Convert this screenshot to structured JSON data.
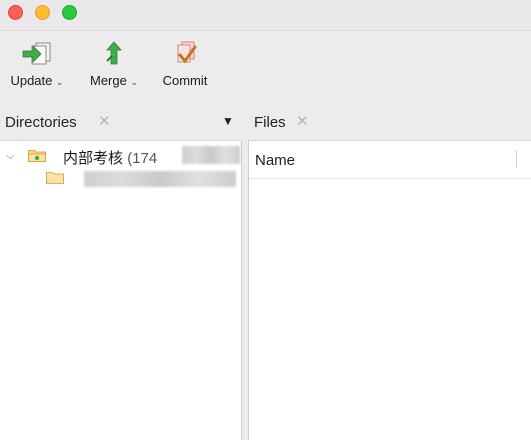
{
  "window": {
    "traffic_lights": [
      "close",
      "minimize",
      "maximize"
    ]
  },
  "toolbar": {
    "update_label": "Update",
    "merge_label": "Merge",
    "commit_label": "Commit",
    "dropdown_glyph": "⌄"
  },
  "directories": {
    "title": "Directories",
    "close_glyph": "✕",
    "menu_glyph": "▼",
    "tree": [
      {
        "label": "内部考核",
        "count_text": "(174",
        "expanded": true
      },
      {
        "label": "",
        "redacted": true
      }
    ]
  },
  "files": {
    "title": "Files",
    "close_glyph": "✕",
    "columns": [
      "Name"
    ]
  },
  "colors": {
    "accent": "#6a9fd8",
    "folder": "#f5c873",
    "update_icon": "#3fae49",
    "merge_icon": "#3fae49",
    "commit_icon": "#e8a090"
  }
}
